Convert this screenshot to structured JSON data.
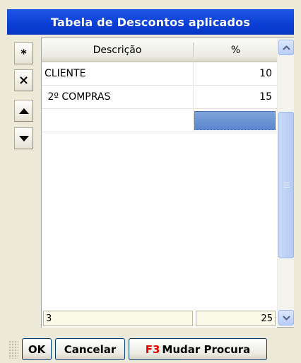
{
  "window": {
    "title": "Tabela de Descontos aplicados"
  },
  "toolbar": {
    "new_label": "*",
    "delete_label": "×",
    "up_icon": "arrow-up-icon",
    "down_icon": "arrow-down-icon"
  },
  "grid": {
    "columns": [
      {
        "label": "Descrição"
      },
      {
        "label": "%"
      }
    ],
    "rows": [
      {
        "descricao": "CLIENTE",
        "percent": "10"
      },
      {
        "descricao": " 2º COMPRAS",
        "percent": "15"
      },
      {
        "descricao": "",
        "percent": ""
      }
    ],
    "footer": {
      "count": "3",
      "total": "25"
    }
  },
  "buttons": {
    "ok": "OK",
    "cancel": "Cancelar",
    "search_hotkey": "F3",
    "search_label": "Mudar Procura"
  },
  "colors": {
    "title_bar": "#0a3fd6",
    "selection": "#6b93d6",
    "hotkey": "#e80000"
  }
}
